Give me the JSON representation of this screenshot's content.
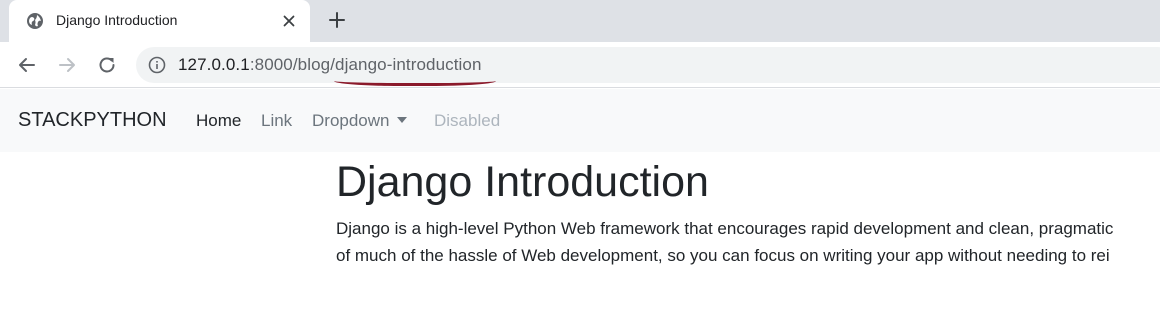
{
  "browser": {
    "tab": {
      "title": "Django Introduction",
      "favicon": "globe-icon",
      "close_icon": "close-icon"
    },
    "new_tab_icon": "plus-icon",
    "toolbar": {
      "back_icon": "back-arrow-icon",
      "forward_icon": "forward-arrow-icon",
      "reload_icon": "reload-icon",
      "info_icon": "info-icon"
    },
    "address_bar": {
      "host": "127.0.0.1",
      "rest": ":8000/blog/django-introduction",
      "highlight_color": "#8b1a2b"
    }
  },
  "navbar": {
    "brand": "STACKPYTHON",
    "links": [
      {
        "label": "Home",
        "state": "active"
      },
      {
        "label": "Link",
        "state": "normal"
      },
      {
        "label": "Dropdown",
        "state": "normal"
      },
      {
        "label": "Disabled",
        "state": "disabled"
      }
    ]
  },
  "post": {
    "title": "Django Introduction",
    "body_line1": "Django is a high-level Python Web framework that encourages rapid development and clean, pragmatic",
    "body_line2": "of much of the hassle of Web development, so you can focus on writing your app without needing to rei"
  },
  "colors": {
    "tabstrip": "#dee1e6",
    "navbar_bg": "#f8f9fa",
    "text": "#212529",
    "muted": "#6c757d",
    "disabled": "#adb5bd"
  }
}
